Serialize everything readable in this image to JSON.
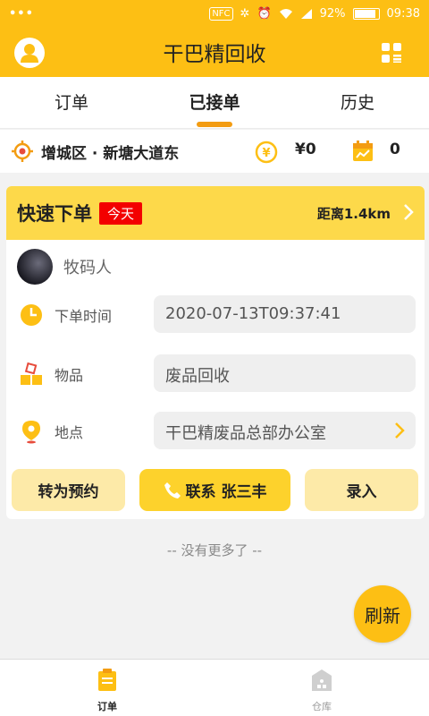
{
  "status_bar": {
    "dots": "•••",
    "nfc": "NFC",
    "battery": "92%",
    "battery_level": 0.92,
    "time": "09:38"
  },
  "header": {
    "title": "干巴精回收"
  },
  "tabs": [
    {
      "label": "订单",
      "active": false
    },
    {
      "label": "已接单",
      "active": true
    },
    {
      "label": "历史",
      "active": false
    }
  ],
  "location_bar": {
    "location": "增城区 · 新塘大道东",
    "money": "¥0",
    "count": "0"
  },
  "order_card": {
    "quick_label": "快速下单",
    "today_badge": "今天",
    "distance": "距离1.4km",
    "user_name": "牧码人",
    "time_label": "下单时间",
    "time_value": "2020-07-13T09:37:41",
    "item_label": "物品",
    "item_value": "废品回收",
    "place_label": "地点",
    "place_value": "干巴精废品总部办公室",
    "btn_reserve": "转为预约",
    "btn_contact": "联系 张三丰",
    "btn_enter": "录入"
  },
  "no_more": "-- 没有更多了 --",
  "refresh_label": "刷新",
  "bottom_nav": [
    {
      "label": "订单",
      "active": true
    },
    {
      "label": "仓库",
      "active": false
    }
  ],
  "colors": {
    "brand": "#fdbf14",
    "card_head": "#fdd94a",
    "badge": "#f30000",
    "tab_indicator": "#f39c12"
  }
}
